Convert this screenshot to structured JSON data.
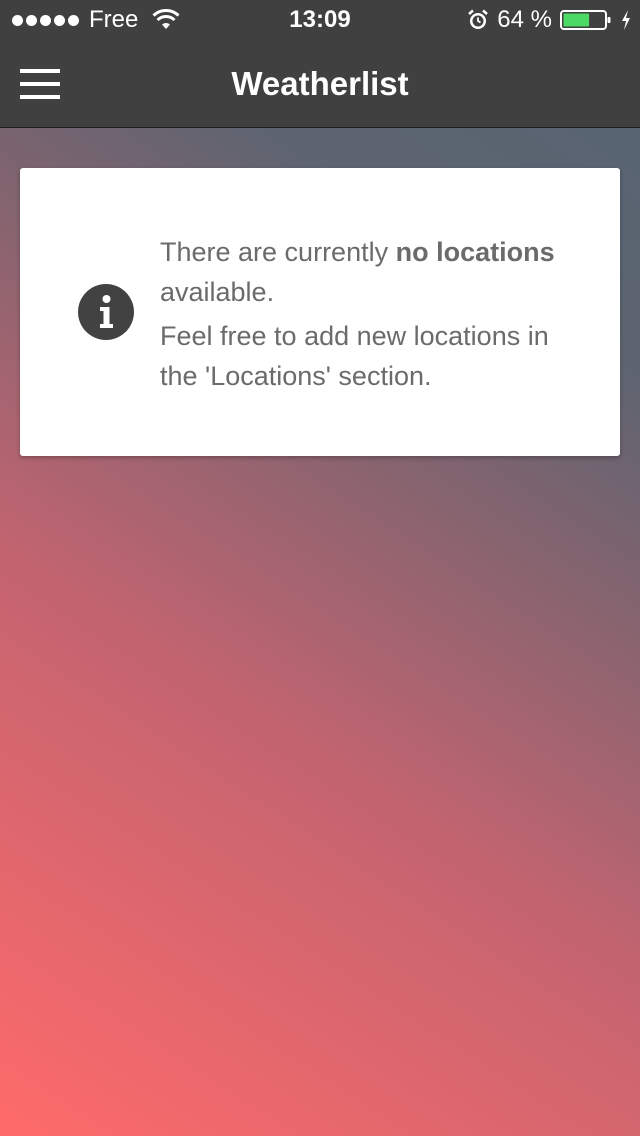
{
  "status_bar": {
    "carrier": "Free",
    "time": "13:09",
    "battery_percent": "64 %",
    "battery_level": 0.64,
    "battery_color": "#4cd964",
    "icons": [
      "signal-dots-icon",
      "wifi-icon",
      "alarm-icon",
      "battery-icon",
      "charging-bolt-icon"
    ]
  },
  "nav": {
    "title": "Weatherlist",
    "menu_icon": "hamburger-menu-icon"
  },
  "info_card": {
    "icon": "info-icon",
    "line1_pre": "There are currently ",
    "line1_bold": "no locations",
    "line1_post": " available.",
    "line2": "Feel free to add new locations in the 'Locations' section."
  },
  "colors": {
    "bar_background": "#404040",
    "gradient_bottom_left": "#ff6a6a",
    "gradient_top_right": "#566473",
    "card_text": "#6b6b6b",
    "info_icon": "#424242"
  }
}
